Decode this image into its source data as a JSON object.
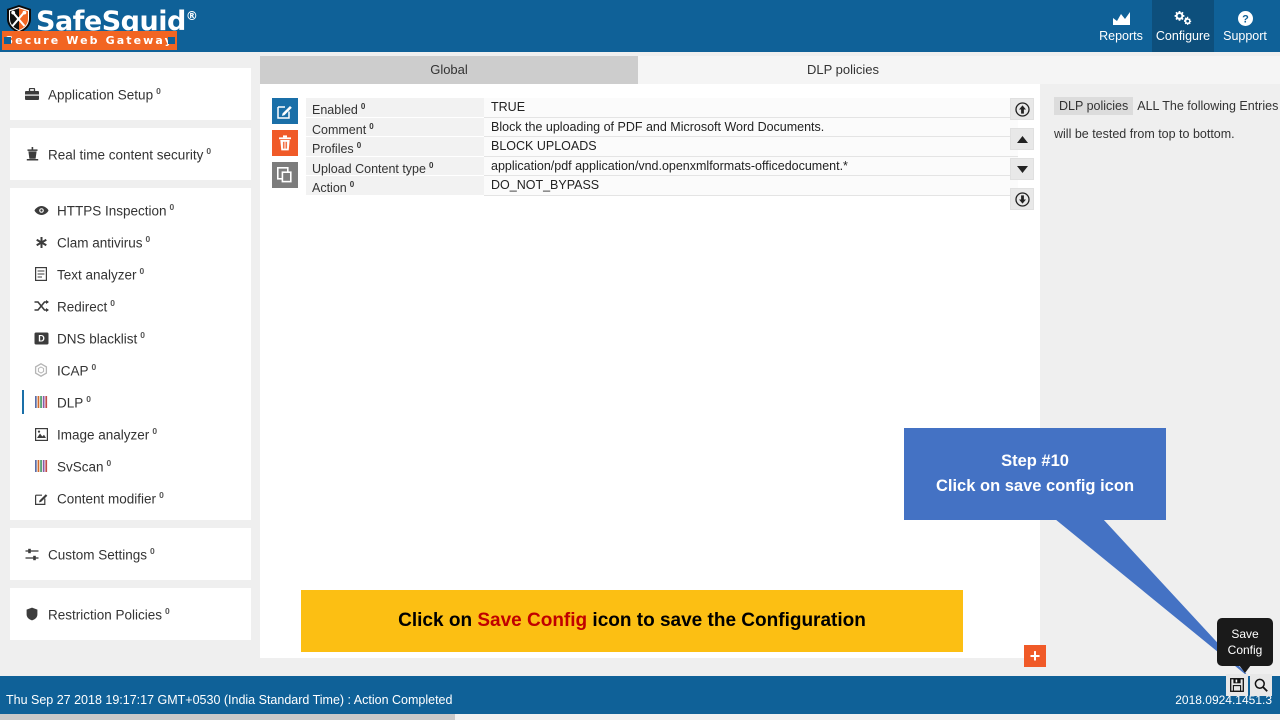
{
  "brand": {
    "name": "SafeSquid",
    "registered": "®",
    "tagline": "Secure Web Gateway",
    "logo_icon": "shield-tools-icon",
    "header_bg": "#0f6198",
    "tagline_bg": "#f26522"
  },
  "topnav": {
    "items": [
      {
        "label": "Reports",
        "icon": "chart-icon",
        "active": false
      },
      {
        "label": "Configure",
        "icon": "gears-icon",
        "active": true
      },
      {
        "label": "Support",
        "icon": "help-circle-icon",
        "active": false
      }
    ]
  },
  "sidebar": {
    "groups": [
      {
        "items": [
          {
            "label": "Application Setup",
            "sup": "0",
            "icon": "briefcase-icon",
            "selected": false,
            "indent": false
          }
        ]
      },
      {
        "items": [
          {
            "label": "Real time content security",
            "sup": "0",
            "icon": "shield-person-icon",
            "selected": false,
            "indent": false
          }
        ]
      },
      {
        "items": [
          {
            "label": "HTTPS Inspection",
            "sup": "0",
            "icon": "eye-icon",
            "selected": false,
            "indent": true
          },
          {
            "label": "Clam antivirus",
            "sup": "0",
            "icon": "asterisk-icon",
            "selected": false,
            "indent": true
          },
          {
            "label": "Text analyzer",
            "sup": "0",
            "icon": "document-text-icon",
            "selected": false,
            "indent": true
          },
          {
            "label": "Redirect",
            "sup": "0",
            "icon": "shuffle-icon",
            "selected": false,
            "indent": true
          },
          {
            "label": "DNS blacklist",
            "sup": "0",
            "icon": "dns-box-icon",
            "selected": false,
            "indent": true
          },
          {
            "label": "ICAP",
            "sup": "0",
            "icon": "hexagon-icon",
            "selected": false,
            "indent": true
          },
          {
            "label": "DLP",
            "sup": "0",
            "icon": "bars-icon",
            "selected": true,
            "indent": true
          },
          {
            "label": "Image analyzer",
            "sup": "0",
            "icon": "image-icon",
            "selected": false,
            "indent": true
          },
          {
            "label": "SvScan",
            "sup": "0",
            "icon": "bars-icon",
            "selected": false,
            "indent": true
          },
          {
            "label": "Content modifier",
            "sup": "0",
            "icon": "edit-square-icon",
            "selected": false,
            "indent": true
          }
        ]
      },
      {
        "items": [
          {
            "label": "Custom Settings",
            "sup": "0",
            "icon": "sliders-icon",
            "selected": false,
            "indent": false
          }
        ]
      },
      {
        "items": [
          {
            "label": "Restriction Policies",
            "sup": "0",
            "icon": "shield-icon",
            "selected": false,
            "indent": false
          }
        ]
      }
    ]
  },
  "tabs": [
    {
      "label": "Global",
      "active": true
    },
    {
      "label": "DLP policies",
      "active": false
    }
  ],
  "row_actions": [
    {
      "name": "edit",
      "icon": "edit-square-icon",
      "color": "#1a6fa8"
    },
    {
      "name": "delete",
      "icon": "trash-icon",
      "color": "#f05a28"
    },
    {
      "name": "copy",
      "icon": "copy-icon",
      "color": "#7c7c7c"
    }
  ],
  "fields": [
    {
      "label": "Enabled",
      "sup": "0",
      "value": "TRUE"
    },
    {
      "label": "Comment",
      "sup": "0",
      "value": "Block the uploading of PDF and Microsoft Word Documents."
    },
    {
      "label": "Profiles",
      "sup": "0",
      "value": "BLOCK UPLOADS"
    },
    {
      "label": "Upload Content type",
      "sup": "0",
      "value": "application/pdf   application/vnd.openxmlformats-officedocument.*"
    },
    {
      "label": "Action",
      "sup": "0",
      "value": "DO_NOT_BYPASS"
    }
  ],
  "nav_buttons": [
    {
      "name": "move-to-top",
      "icon": "circle-arrow-up-icon"
    },
    {
      "name": "move-up",
      "icon": "triangle-up-icon"
    },
    {
      "name": "move-down",
      "icon": "triangle-down-icon"
    },
    {
      "name": "move-to-bottom",
      "icon": "circle-arrow-down-icon"
    }
  ],
  "add_button": {
    "label": "+",
    "icon": "plus-icon",
    "color": "#f05a28"
  },
  "note": {
    "tag": "DLP policies",
    "line1_rest": "ALL The following Entries",
    "line2": "will be tested from top to bottom."
  },
  "callout": {
    "line1": "Step #10",
    "line2": "Click on save config icon",
    "color": "#4472c4"
  },
  "banner": {
    "prefix": "Click on ",
    "highlight": "Save Config",
    "suffix": " icon to save the Configuration",
    "bg": "#fcbf13",
    "highlight_color": "#c00000"
  },
  "tooltip": {
    "line1": "Save",
    "line2": "Config"
  },
  "bottom": {
    "status": "Thu Sep 27 2018 19:17:17 GMT+0530 (India Standard Time) : Action Completed",
    "version": "2018.0924.1451.3",
    "icons": [
      {
        "name": "save-config-icon",
        "icon": "floppy-disk-icon"
      },
      {
        "name": "search-icon",
        "icon": "magnifier-icon"
      }
    ]
  }
}
